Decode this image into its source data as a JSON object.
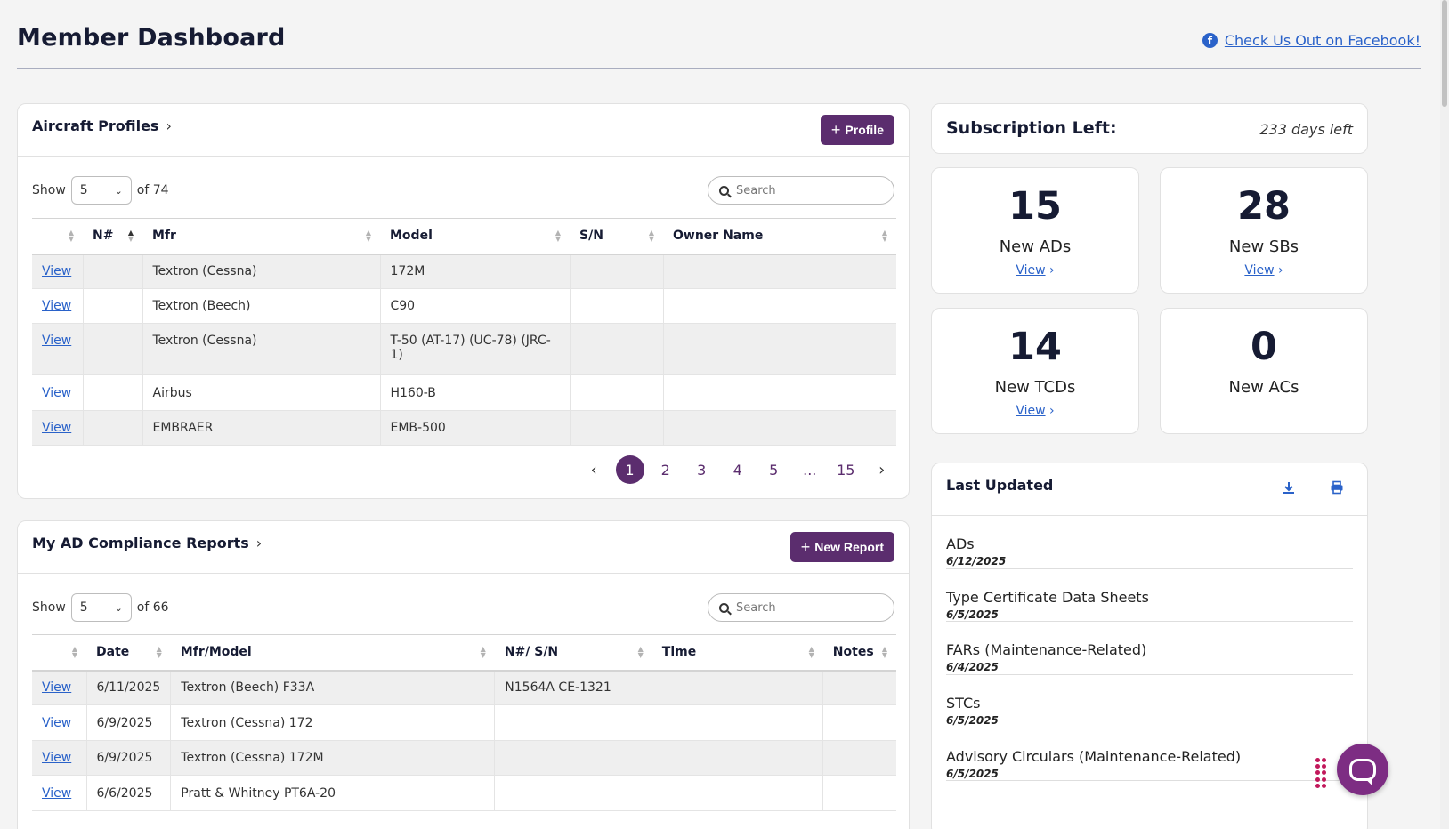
{
  "header": {
    "title": "Member Dashboard",
    "facebook_link": "Check Us Out on Facebook!"
  },
  "aircraft": {
    "title": "Aircraft Profiles",
    "add_label": "Profile",
    "show_label": "Show",
    "page_size": "5",
    "of_total": "of 74",
    "search_placeholder": "Search",
    "columns": [
      "N#",
      "Mfr",
      "Model",
      "S/N",
      "Owner Name"
    ],
    "rows": [
      {
        "view": "View",
        "n": "",
        "mfr": "Textron (Cessna)",
        "model": "172M",
        "sn": "",
        "owner": ""
      },
      {
        "view": "View",
        "n": "",
        "mfr": "Textron (Beech)",
        "model": "C90",
        "sn": "",
        "owner": ""
      },
      {
        "view": "View",
        "n": "",
        "mfr": "Textron (Cessna)",
        "model": "T-50 (AT-17) (UC-78) (JRC-1)",
        "sn": "",
        "owner": ""
      },
      {
        "view": "View",
        "n": "",
        "mfr": "Airbus",
        "model": "H160-B",
        "sn": "",
        "owner": ""
      },
      {
        "view": "View",
        "n": "",
        "mfr": "EMBRAER",
        "model": "EMB-500",
        "sn": "",
        "owner": ""
      }
    ],
    "pagination": {
      "pages": [
        "1",
        "2",
        "3",
        "4",
        "5",
        "...",
        "15"
      ],
      "current": "1"
    }
  },
  "reports": {
    "title": "My AD Compliance Reports",
    "add_label": "New Report",
    "show_label": "Show",
    "page_size": "5",
    "of_total": "of 66",
    "search_placeholder": "Search",
    "columns": [
      "Date",
      "Mfr/Model",
      "N#/ S/N",
      "Time",
      "Notes"
    ],
    "rows": [
      {
        "view": "View",
        "date": "6/11/2025",
        "model": "Textron (Beech) F33A",
        "nsn": "N1564A CE-1321",
        "time": "",
        "notes": ""
      },
      {
        "view": "View",
        "date": "6/9/2025",
        "model": "Textron (Cessna) 172",
        "nsn": "",
        "time": "",
        "notes": ""
      },
      {
        "view": "View",
        "date": "6/9/2025",
        "model": "Textron (Cessna) 172M",
        "nsn": "",
        "time": "",
        "notes": ""
      },
      {
        "view": "View",
        "date": "6/6/2025",
        "model": "Pratt & Whitney PT6A-20",
        "nsn": "",
        "time": "",
        "notes": ""
      }
    ]
  },
  "subscription": {
    "label": "Subscription Left:",
    "days": "233 days left"
  },
  "stats": [
    {
      "value": "15",
      "label": "New ADs",
      "view": "View"
    },
    {
      "value": "28",
      "label": "New SBs",
      "view": "View"
    },
    {
      "value": "14",
      "label": "New TCDs",
      "view": "View"
    },
    {
      "value": "0",
      "label": "New ACs",
      "view": ""
    }
  ],
  "last_updated": {
    "title": "Last Updated",
    "download_icon": "download-icon",
    "print_icon": "printer-icon",
    "items": [
      {
        "name": "ADs",
        "date": "6/12/2025"
      },
      {
        "name": "Type Certificate Data Sheets",
        "date": "6/5/2025"
      },
      {
        "name": "FARs (Maintenance-Related)",
        "date": "6/4/2025"
      },
      {
        "name": "STCs",
        "date": "6/5/2025"
      },
      {
        "name": "Advisory Circulars (Maintenance-Related)",
        "date": "6/5/2025"
      }
    ]
  },
  "colors": {
    "brand_purple": "#5b2d6e",
    "link_blue": "#2a62c9",
    "chat_purple": "#7d2d83"
  }
}
